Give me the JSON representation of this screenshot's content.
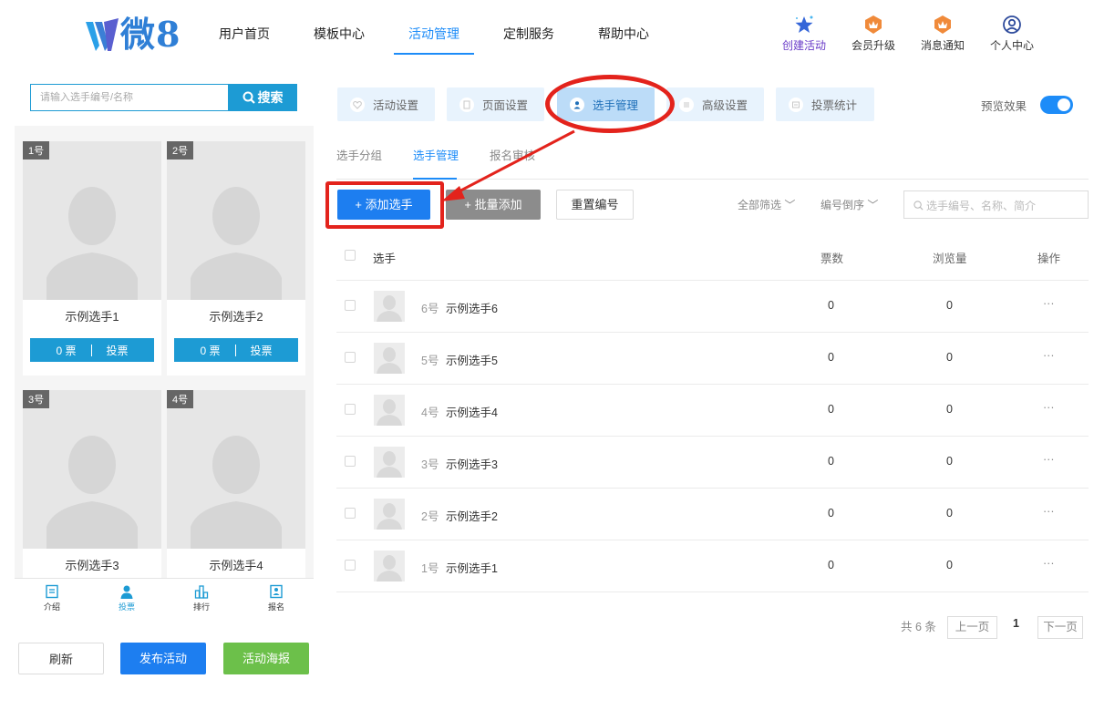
{
  "header": {
    "logo_text": "微8",
    "nav": [
      "用户首页",
      "模板中心",
      "活动管理",
      "定制服务",
      "帮助中心"
    ],
    "nav_active_index": 2,
    "actions": [
      "创建活动",
      "会员升级",
      "消息通知",
      "个人中心"
    ]
  },
  "preview": {
    "search_placeholder": "请输入选手编号/名称",
    "search_button": "搜索",
    "cards": [
      {
        "tag": "1号",
        "name": "示例选手1",
        "votes": "0 票",
        "vote_btn": "投票"
      },
      {
        "tag": "2号",
        "name": "示例选手2",
        "votes": "0 票",
        "vote_btn": "投票"
      },
      {
        "tag": "3号",
        "name": "示例选手3"
      },
      {
        "tag": "4号",
        "name": "示例选手4"
      }
    ],
    "tabs": [
      "介绍",
      "投票",
      "排行",
      "报名"
    ],
    "tabs_active_index": 1
  },
  "buttons": {
    "refresh": "刷新",
    "publish": "发布活动",
    "poster": "活动海报"
  },
  "steps": [
    "活动设置",
    "页面设置",
    "选手管理",
    "高级设置",
    "投票统计"
  ],
  "steps_active_index": 2,
  "preview_effect": "预览效果",
  "subtabs": [
    "选手分组",
    "选手管理",
    "报名审核"
  ],
  "subtabs_active_index": 1,
  "toolbar": {
    "add": "+ 添加选手",
    "batch_add": "+ 批量添加",
    "reset_numbers": "重置编号",
    "filter_all": "全部筛选",
    "sort_number": "编号倒序",
    "search_placeholder": "选手编号、名称、简介"
  },
  "table": {
    "headers": {
      "player": "选手",
      "votes": "票数",
      "views": "浏览量",
      "ops": "操作"
    },
    "rows": [
      {
        "num": "6号",
        "name": "示例选手6",
        "votes": "0",
        "views": "0",
        "ops": "···"
      },
      {
        "num": "5号",
        "name": "示例选手5",
        "votes": "0",
        "views": "0",
        "ops": "···"
      },
      {
        "num": "4号",
        "name": "示例选手4",
        "votes": "0",
        "views": "0",
        "ops": "···"
      },
      {
        "num": "3号",
        "name": "示例选手3",
        "votes": "0",
        "views": "0",
        "ops": "···"
      },
      {
        "num": "2号",
        "name": "示例选手2",
        "votes": "0",
        "views": "0",
        "ops": "···"
      },
      {
        "num": "1号",
        "name": "示例选手1",
        "votes": "0",
        "views": "0",
        "ops": "···"
      }
    ]
  },
  "pagination": {
    "total": "共 6 条",
    "prev": "上一页",
    "page": "1",
    "next": "下一页"
  },
  "colors": {
    "accent": "#1d8cf8",
    "preview_accent": "#1d9bd4",
    "annotation_red": "#e3231c",
    "poster_green": "#6cc04a"
  }
}
